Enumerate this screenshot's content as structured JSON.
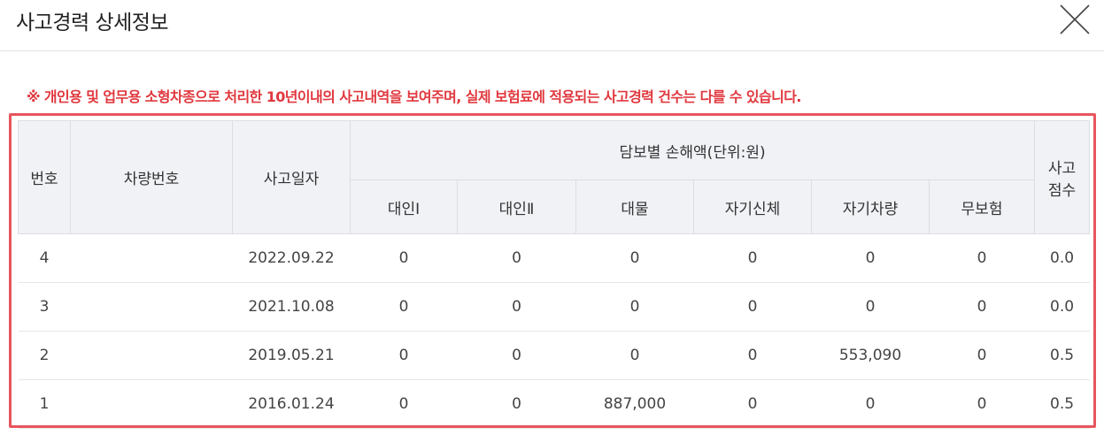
{
  "title": "사고경력 상세정보",
  "notice": "※ 개인용 및 업무용 소형차종으로 처리한 10년이내의 사고내역을 보여주며, 실제 보험료에 적용되는 사고경력 건수는 다를 수 있습니다.",
  "table": {
    "headers": {
      "no": "번호",
      "car": "차량번호",
      "date": "사고일자",
      "loss_group": "담보별 손해액(단위:원)",
      "d1": "대인Ⅰ",
      "d2": "대인Ⅱ",
      "prop": "대물",
      "self_body": "자기신체",
      "self_car": "자기차량",
      "uninsured": "무보험",
      "score_1": "사고",
      "score_2": "점수"
    },
    "rows": [
      {
        "no": "4",
        "car": "",
        "date": "2022.09.22",
        "d1": "0",
        "d2": "0",
        "prop": "0",
        "self_body": "0",
        "self_car": "0",
        "uninsured": "0",
        "score": "0.0"
      },
      {
        "no": "3",
        "car": "",
        "date": "2021.10.08",
        "d1": "0",
        "d2": "0",
        "prop": "0",
        "self_body": "0",
        "self_car": "0",
        "uninsured": "0",
        "score": "0.0"
      },
      {
        "no": "2",
        "car": "",
        "date": "2019.05.21",
        "d1": "0",
        "d2": "0",
        "prop": "0",
        "self_body": "0",
        "self_car": "553,090",
        "uninsured": "0",
        "score": "0.5"
      },
      {
        "no": "1",
        "car": "",
        "date": "2016.01.24",
        "d1": "0",
        "d2": "0",
        "prop": "887,000",
        "self_body": "0",
        "self_car": "0",
        "uninsured": "0",
        "score": "0.5"
      }
    ]
  },
  "colors": {
    "notice": "#e0383e",
    "highlight_border": "#e8555d",
    "header_bg": "#f1f2f6"
  },
  "icons": {
    "close": "close-icon"
  }
}
